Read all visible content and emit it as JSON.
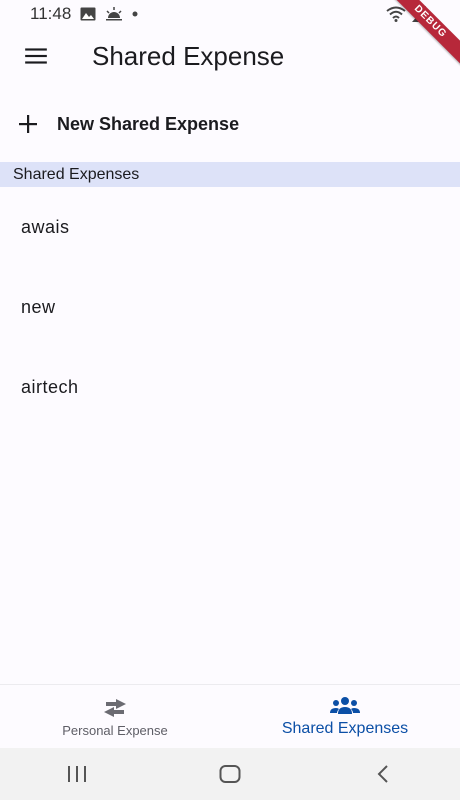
{
  "status": {
    "time": "11:48"
  },
  "debug_banner": "DEBUG",
  "appbar": {
    "title": "Shared Expense"
  },
  "actions": {
    "new_label": "New Shared Expense"
  },
  "section": {
    "header": "Shared Expenses"
  },
  "list": {
    "items": [
      {
        "label": "awais"
      },
      {
        "label": "new"
      },
      {
        "label": "airtech"
      }
    ]
  },
  "bottom_nav": {
    "items": [
      {
        "label": "Personal Expense",
        "icon": "swap-arrows-icon",
        "active": false
      },
      {
        "label": "Shared Expenses",
        "icon": "group-icon",
        "active": true
      }
    ]
  },
  "colors": {
    "background": "#fdfbff",
    "section_header": "#dde2f8",
    "active_nav": "#0b4fa6",
    "inactive_nav": "#5e5e66",
    "debug_banner": "#b7283a"
  }
}
